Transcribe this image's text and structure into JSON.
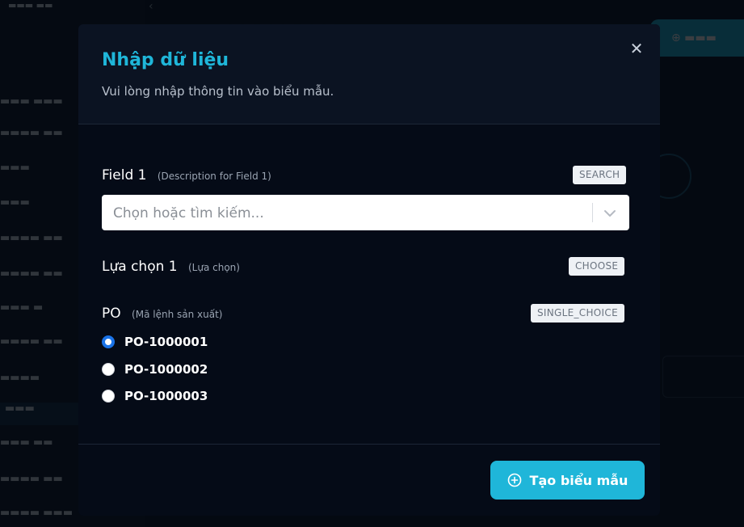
{
  "modal": {
    "title": "Nhập dữ liệu",
    "subtitle": "Vui lòng nhập thông tin vào biểu mẫu.",
    "close_icon": "close-icon",
    "submit_label": "Tạo biểu mẫu",
    "submit_icon": "plus-circle-icon"
  },
  "fields": {
    "field1": {
      "label": "Field 1",
      "description": "(Description for Field 1)",
      "type": "SEARCH",
      "placeholder": "Chọn hoặc tìm kiếm...",
      "value": ""
    },
    "choice1": {
      "label": "Lựa chọn 1",
      "description": "(Lựa chọn)",
      "type": "CHOOSE"
    },
    "po": {
      "label": "PO",
      "description": "(Mã lệnh sản xuất)",
      "type": "SINGLE_CHOICE",
      "selected_index": 0,
      "options": [
        "PO-1000001",
        "PO-1000002",
        "PO-1000003"
      ]
    }
  },
  "colors": {
    "accent": "#1fb6d9",
    "radio_checked": "#1a73e8",
    "modal_bg": "#050b17"
  }
}
